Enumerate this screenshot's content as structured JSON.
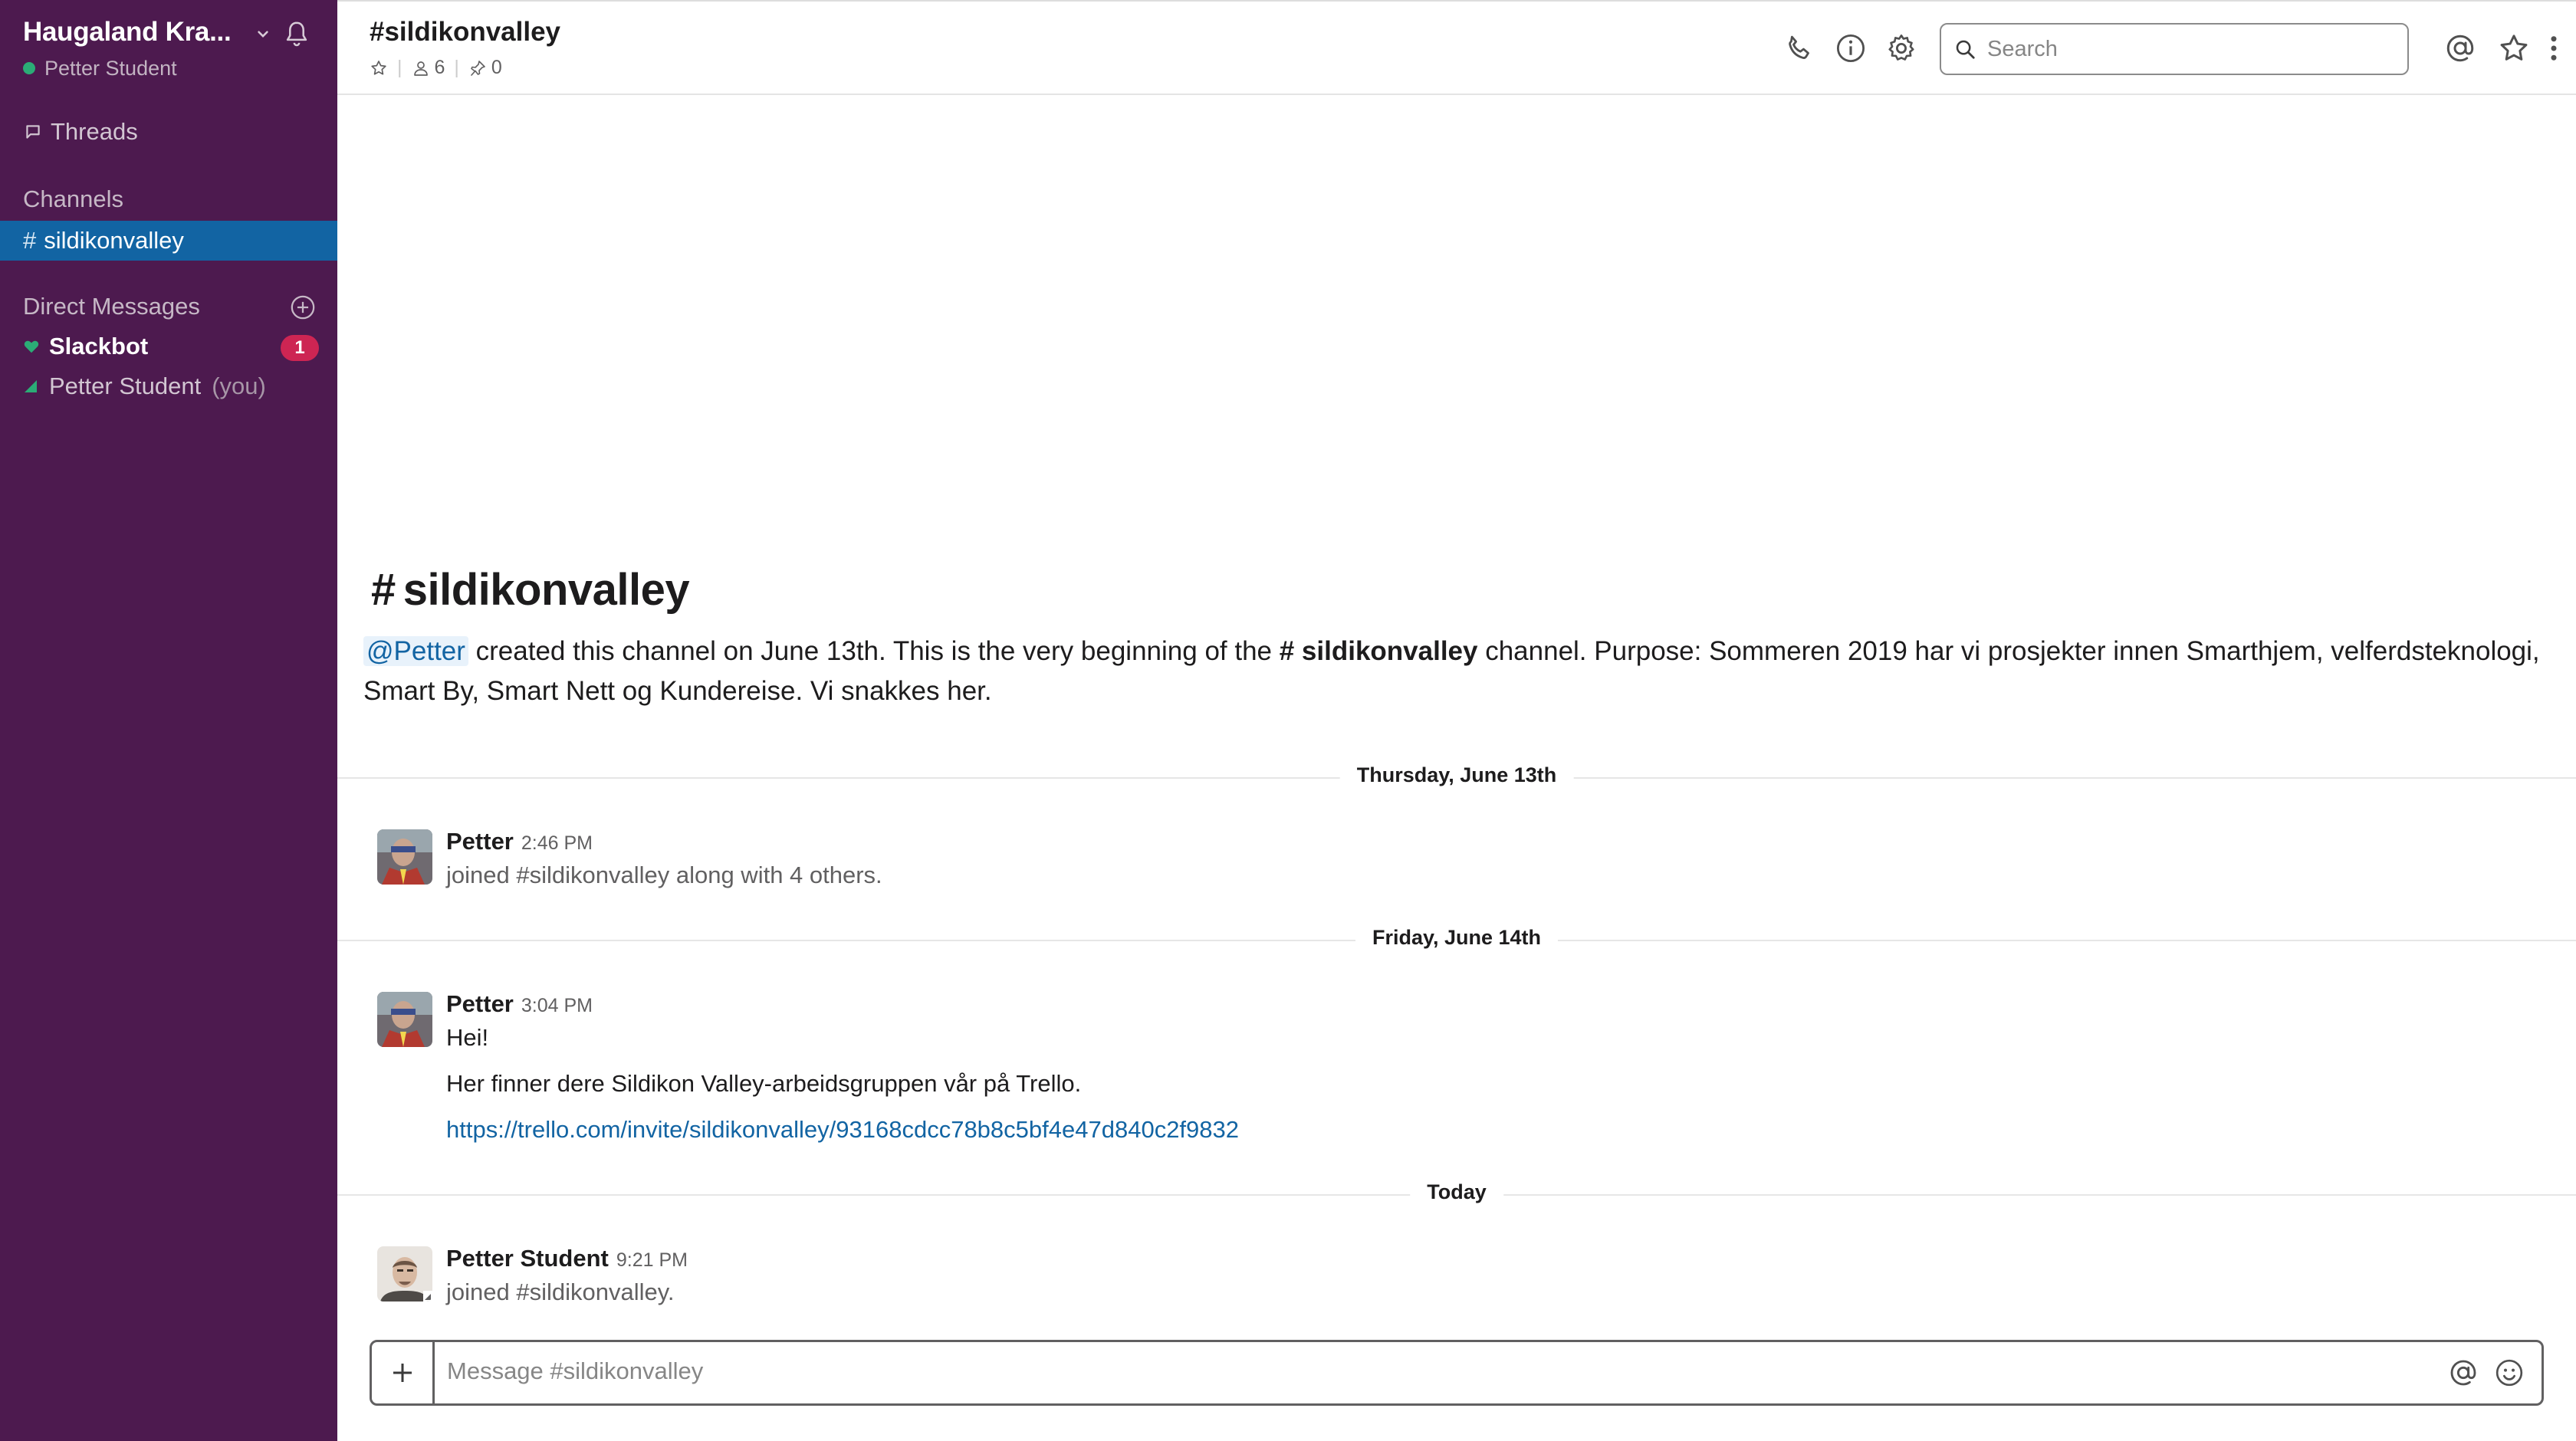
{
  "workspace": {
    "name": "Haugaland Kra...",
    "user": "Petter Student"
  },
  "sidebar": {
    "threads_label": "Threads",
    "channels_header": "Channels",
    "channels": [
      {
        "hash": "#",
        "name": "sildikonvalley",
        "active": true
      }
    ],
    "dms_header": "Direct Messages",
    "dms": [
      {
        "name": "Slackbot",
        "badge": "1"
      },
      {
        "name": "Petter Student",
        "suffix": "(you)"
      }
    ]
  },
  "header": {
    "channel_title": "#sildikonvalley",
    "member_count": "6",
    "pinned_count": "0",
    "search_placeholder": "Search"
  },
  "intro": {
    "hash": "#",
    "channel_name": "sildikonvalley",
    "mention": "@Petter",
    "text_before": " created this channel on June 13th. This is the very beginning of the ",
    "channel_ref": "# sildikonvalley",
    "text_after": " channel. Purpose: Sommeren 2019 har vi prosjekter innen Smarthjem, velferdsteknologi, Smart By, Smart Nett og Kundereise. Vi snakkes her."
  },
  "days": [
    {
      "label": "Thursday, June 13th"
    },
    {
      "label": "Friday, June 14th"
    },
    {
      "label": "Today"
    }
  ],
  "messages": [
    {
      "author": "Petter",
      "time": "2:46 PM",
      "lines": [
        "joined #sildikonvalley along with 4 others."
      ]
    },
    {
      "author": "Petter",
      "time": "3:04 PM",
      "lines": [
        "Hei!",
        "Her finner dere Sildikon Valley-arbeidsgruppen vår på Trello."
      ],
      "link": "https://trello.com/invite/sildikonvalley/93168cdcc78b8c5bf4e47d840c2f9832"
    },
    {
      "author": "Petter Student",
      "time": "9:21 PM",
      "lines": [
        "joined #sildikonvalley."
      ]
    }
  ],
  "composer": {
    "placeholder": "Message #sildikonvalley"
  },
  "colors": {
    "sidebar_bg": "#4d1a4f",
    "active_channel": "#1264a3",
    "badge": "#cd2553",
    "presence": "#2bac76",
    "link": "#1264a3"
  }
}
